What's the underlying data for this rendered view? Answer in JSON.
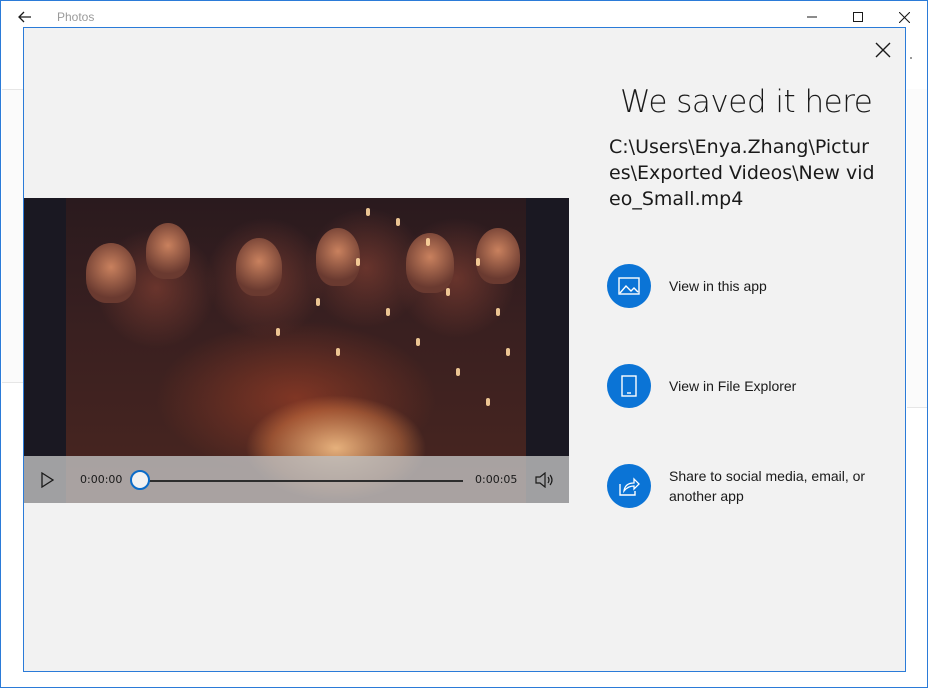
{
  "window": {
    "title": "Photos",
    "icons": [
      "back-arrow-icon",
      "minimize-icon",
      "maximize-icon",
      "close-icon"
    ]
  },
  "dialog": {
    "heading": "We saved it here",
    "path": "C:\\Users\\Enya.Zhang\\Pictures\\Exported Videos\\New video_Small.mp4",
    "close_icon": "close-icon"
  },
  "player": {
    "current_time": "0:00:00",
    "total_time": "0:00:05",
    "progress": 0,
    "icons": [
      "play-icon",
      "volume-icon"
    ]
  },
  "actions": [
    {
      "label": "View in this app",
      "icon": "image-icon"
    },
    {
      "label": "View in File Explorer",
      "icon": "tablet-icon"
    },
    {
      "label": "Share to social media, email, or another app",
      "icon": "share-icon"
    }
  ],
  "colors": {
    "accent": "#0b74d6",
    "border": "#2b7bd8",
    "dialog_bg": "#f2f2f2"
  }
}
